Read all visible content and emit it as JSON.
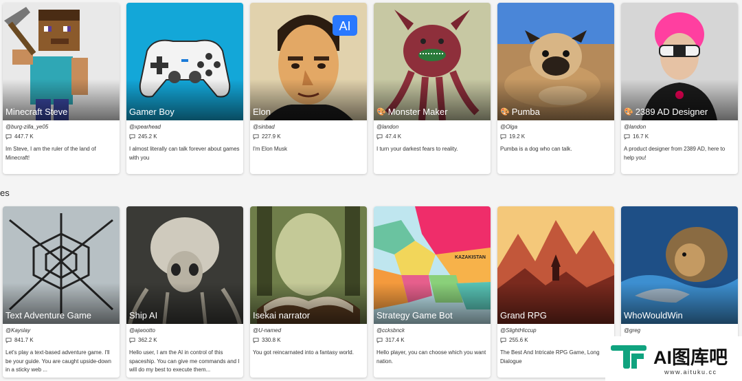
{
  "rows": [
    {
      "cards": [
        {
          "title": "Minecraft Steve",
          "author": "@burg-zilla_ye05",
          "chats": "447.7 K",
          "description": "Im Steve, I am the ruler of the land of Minecraft!"
        },
        {
          "title": "Gamer Boy",
          "author": "@xpearhead",
          "chats": "245.2 K",
          "description": "I almost literally can talk forever about games with you"
        },
        {
          "title": "Elon",
          "author": "@sinbad",
          "chats": "227.9 K",
          "description": "I'm Elon Musk",
          "badge": "AI"
        },
        {
          "title": "Monster Maker",
          "author": "@landon",
          "chats": "47.4 K",
          "description": "I turn your darkest fears to reality.",
          "palette_icon": "🎨"
        },
        {
          "title": "Pumba",
          "author": "@Olga",
          "chats": "19.2 K",
          "description": "Pumba is a dog who can talk.",
          "palette_icon": "🎨"
        },
        {
          "title": "2389 AD Designer",
          "author": "@landon",
          "chats": "16.7 K",
          "description": "A product designer from 2389 AD, here to help you!",
          "palette_icon": "🎨"
        }
      ]
    },
    {
      "label": "es",
      "cards": [
        {
          "title": "Text Adventure Game",
          "author": "@Kayslay",
          "chats": "841.7 K",
          "description": "Let's play a text-based adventure game. I'll be your guide. You are caught upside-down in a sticky web ..."
        },
        {
          "title": "Ship AI",
          "author": "@ajwootto",
          "chats": "362.2 K",
          "description": "Hello user, I am the AI in control of this spaceship. You can give me commands and I will do my best to execute them..."
        },
        {
          "title": "Isekai narrator",
          "author": "@U-named",
          "chats": "330.8 K",
          "description": "You got reincarnated into a fantasy world."
        },
        {
          "title": "Strategy Game Bot",
          "author": "@ccksbnck",
          "chats": "317.4 K",
          "description": "Hello player, you can choose which you want nation.",
          "map_label": "KAZAKISTAN"
        },
        {
          "title": "Grand RPG",
          "author": "@SlightHiccup",
          "chats": "255.6 K",
          "description": "The Best And Intricate RPG Game, Long Dialogue"
        },
        {
          "title": "WhoWouldWin",
          "author": "@greg",
          "chats": "",
          "description": ""
        }
      ]
    }
  ],
  "watermark": {
    "brand": "AI图库吧",
    "url": "www.aituku.cc"
  }
}
